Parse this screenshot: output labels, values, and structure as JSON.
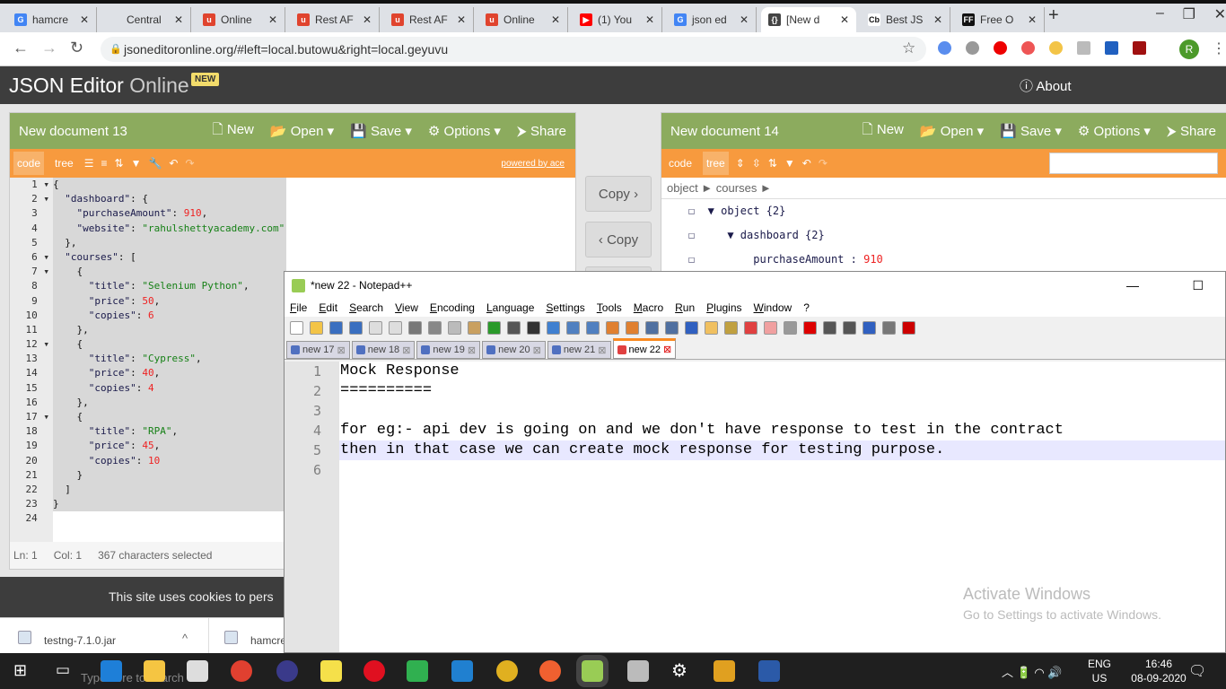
{
  "browser": {
    "tabs": [
      {
        "title": "hamcre",
        "fav": "G",
        "color": "#4285f4"
      },
      {
        "title": "Central",
        "fav": "",
        "color": "#dee1e6"
      },
      {
        "title": "Online",
        "fav": "u",
        "color": "#e0442e"
      },
      {
        "title": "Rest AF",
        "fav": "u",
        "color": "#e0442e"
      },
      {
        "title": "Rest AF",
        "fav": "u",
        "color": "#e0442e"
      },
      {
        "title": "Online",
        "fav": "u",
        "color": "#e0442e"
      },
      {
        "title": "(1) You",
        "fav": "▶",
        "color": "#ff0000"
      },
      {
        "title": "json ed",
        "fav": "G",
        "color": "#4285f4"
      },
      {
        "title": "[New d",
        "fav": "{}",
        "color": "#444",
        "active": true
      },
      {
        "title": "Best JS",
        "fav": "Cb",
        "color": "#fff"
      },
      {
        "title": "Free O",
        "fav": "FF",
        "color": "#111"
      }
    ],
    "url": "jsoneditoronline.org/#left=local.butowu&right=local.geyuvu",
    "profile_initial": "R"
  },
  "app": {
    "title_bold": "JSON Editor",
    "title_light": "Online",
    "badge": "NEW",
    "about": "About"
  },
  "left": {
    "doc_title": "New document 13",
    "new": "New",
    "open": "Open",
    "save": "Save",
    "options": "Options",
    "share": "Share",
    "mode_code": "code",
    "mode_tree": "tree",
    "powered": "powered by ace",
    "code": [
      [
        [
          "{",
          "p"
        ]
      ],
      [
        [
          "  \"dashboard\"",
          "k"
        ],
        [
          ": {",
          "p"
        ]
      ],
      [
        [
          "    \"purchaseAmount\"",
          "k"
        ],
        [
          ": ",
          "p"
        ],
        [
          "910",
          "n"
        ],
        [
          ",",
          "p"
        ]
      ],
      [
        [
          "    \"website\"",
          "k"
        ],
        [
          ": ",
          "p"
        ],
        [
          "\"rahulshettyacademy.com\"",
          "s"
        ]
      ],
      [
        [
          "  },",
          "p"
        ]
      ],
      [
        [
          "  \"courses\"",
          "k"
        ],
        [
          ": [",
          "p"
        ]
      ],
      [
        [
          "    {",
          "p"
        ]
      ],
      [
        [
          "      \"title\"",
          "k"
        ],
        [
          ": ",
          "p"
        ],
        [
          "\"Selenium Python\"",
          "s"
        ],
        [
          ",",
          "p"
        ]
      ],
      [
        [
          "      \"price\"",
          "k"
        ],
        [
          ": ",
          "p"
        ],
        [
          "50",
          "n"
        ],
        [
          ",",
          "p"
        ]
      ],
      [
        [
          "      \"copies\"",
          "k"
        ],
        [
          ": ",
          "p"
        ],
        [
          "6",
          "n"
        ]
      ],
      [
        [
          "    },",
          "p"
        ]
      ],
      [
        [
          "    {",
          "p"
        ]
      ],
      [
        [
          "      \"title\"",
          "k"
        ],
        [
          ": ",
          "p"
        ],
        [
          "\"Cypress\"",
          "s"
        ],
        [
          ",",
          "p"
        ]
      ],
      [
        [
          "      \"price\"",
          "k"
        ],
        [
          ": ",
          "p"
        ],
        [
          "40",
          "n"
        ],
        [
          ",",
          "p"
        ]
      ],
      [
        [
          "      \"copies\"",
          "k"
        ],
        [
          ": ",
          "p"
        ],
        [
          "4",
          "n"
        ]
      ],
      [
        [
          "    },",
          "p"
        ]
      ],
      [
        [
          "    {",
          "p"
        ]
      ],
      [
        [
          "      \"title\"",
          "k"
        ],
        [
          ": ",
          "p"
        ],
        [
          "\"RPA\"",
          "s"
        ],
        [
          ",",
          "p"
        ]
      ],
      [
        [
          "      \"price\"",
          "k"
        ],
        [
          ": ",
          "p"
        ],
        [
          "45",
          "n"
        ],
        [
          ",",
          "p"
        ]
      ],
      [
        [
          "      \"copies\"",
          "k"
        ],
        [
          ": ",
          "p"
        ],
        [
          "10",
          "n"
        ]
      ],
      [
        [
          "    }",
          "p"
        ]
      ],
      [
        [
          "  ]",
          "p"
        ]
      ],
      [
        [
          "}",
          "p"
        ]
      ],
      [
        [
          "",
          "p"
        ]
      ]
    ],
    "fold_lines": [
      1,
      2,
      6,
      7,
      12,
      17
    ],
    "status": {
      "ln": "Ln: 1",
      "col": "Col: 1",
      "selected": "367 characters selected"
    }
  },
  "middle": {
    "copy_right": "Copy ›",
    "copy_left": "‹ Copy"
  },
  "right": {
    "doc_title": "New document 14",
    "new": "New",
    "open": "Open",
    "save": "Save",
    "options": "Options",
    "share": "Share",
    "mode_code": "code",
    "mode_tree": "tree",
    "search_placeholder": "",
    "breadcrumb": [
      "object ►",
      "courses ►"
    ],
    "tree": [
      {
        "label": "object {2}"
      },
      {
        "label": "dashboard {2}"
      },
      {
        "key": "purchaseAmount",
        "value": "910"
      }
    ]
  },
  "cookie": "This site uses cookies to pers",
  "downloads": [
    {
      "name": "testng-7.1.0.jar"
    },
    {
      "name": "hamcre"
    }
  ],
  "notepad": {
    "title": "*new 22 - Notepad++",
    "menu": [
      "File",
      "Edit",
      "Search",
      "View",
      "Encoding",
      "Language",
      "Settings",
      "Tools",
      "Macro",
      "Run",
      "Plugins",
      "Window",
      "?"
    ],
    "tabs": [
      {
        "label": "new 17"
      },
      {
        "label": "new 18"
      },
      {
        "label": "new 19"
      },
      {
        "label": "new 20"
      },
      {
        "label": "new 21"
      },
      {
        "label": "new 22",
        "active": true
      }
    ],
    "lines": [
      "Mock Response",
      "==========",
      "",
      "for eg:- api dev is going on and we don't have response to test in the contract",
      "then in that case we can create mock response for testing purpose.",
      ""
    ],
    "current_line": 5
  },
  "watermark": {
    "title": "Activate Windows",
    "subtitle": "Go to Settings to activate Windows."
  },
  "taskbar": {
    "search": "Type here to search",
    "lang1": "ENG",
    "lang2": "US",
    "time": "16:46",
    "date": "08-09-2020"
  }
}
